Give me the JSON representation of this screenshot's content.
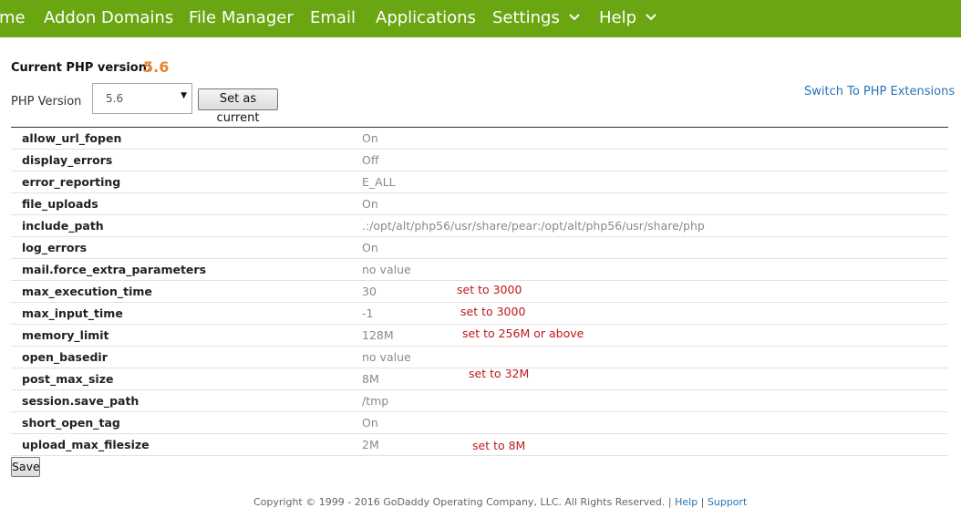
{
  "nav": {
    "items": [
      {
        "label": "me",
        "dropdown": false
      },
      {
        "label": "Addon Domains",
        "dropdown": false
      },
      {
        "label": "File Manager",
        "dropdown": false
      },
      {
        "label": "Email",
        "dropdown": false
      },
      {
        "label": "Applications",
        "dropdown": false
      },
      {
        "label": "Settings",
        "dropdown": true
      },
      {
        "label": "Help",
        "dropdown": true
      }
    ]
  },
  "php": {
    "current_label": "Current PHP version:",
    "current_value": "5.6",
    "version_label": "PHP Version",
    "selected_version": "5.6",
    "set_button": "Set as current",
    "switch_link": "Switch To PHP Extensions"
  },
  "settings": [
    {
      "key": "allow_url_fopen",
      "value": "On",
      "note": ""
    },
    {
      "key": "display_errors",
      "value": "Off",
      "note": ""
    },
    {
      "key": "error_reporting",
      "value": "E_ALL",
      "note": ""
    },
    {
      "key": "file_uploads",
      "value": "On",
      "note": ""
    },
    {
      "key": "include_path",
      "value": ".:/opt/alt/php56/usr/share/pear:/opt/alt/php56/usr/share/php",
      "note": ""
    },
    {
      "key": "log_errors",
      "value": "On",
      "note": ""
    },
    {
      "key": "mail.force_extra_parameters",
      "value": "no value",
      "note": ""
    },
    {
      "key": "max_execution_time",
      "value": "30",
      "note": "set to 3000"
    },
    {
      "key": "max_input_time",
      "value": "-1",
      "note": "set to 3000"
    },
    {
      "key": "memory_limit",
      "value": "128M",
      "note": "set to 256M or above"
    },
    {
      "key": "open_basedir",
      "value": "no value",
      "note": ""
    },
    {
      "key": "post_max_size",
      "value": "8M",
      "note": "set to 32M"
    },
    {
      "key": "session.save_path",
      "value": "/tmp",
      "note": ""
    },
    {
      "key": "short_open_tag",
      "value": "On",
      "note": ""
    },
    {
      "key": "upload_max_filesize",
      "value": "2M",
      "note": "set to 8M"
    }
  ],
  "save_button": "Save",
  "footer": {
    "copyright": "Copyright © 1999 - 2016 GoDaddy Operating Company, LLC. All Rights Reserved.",
    "sep1": " | ",
    "help": "Help",
    "sep2": " | ",
    "support": "Support"
  }
}
